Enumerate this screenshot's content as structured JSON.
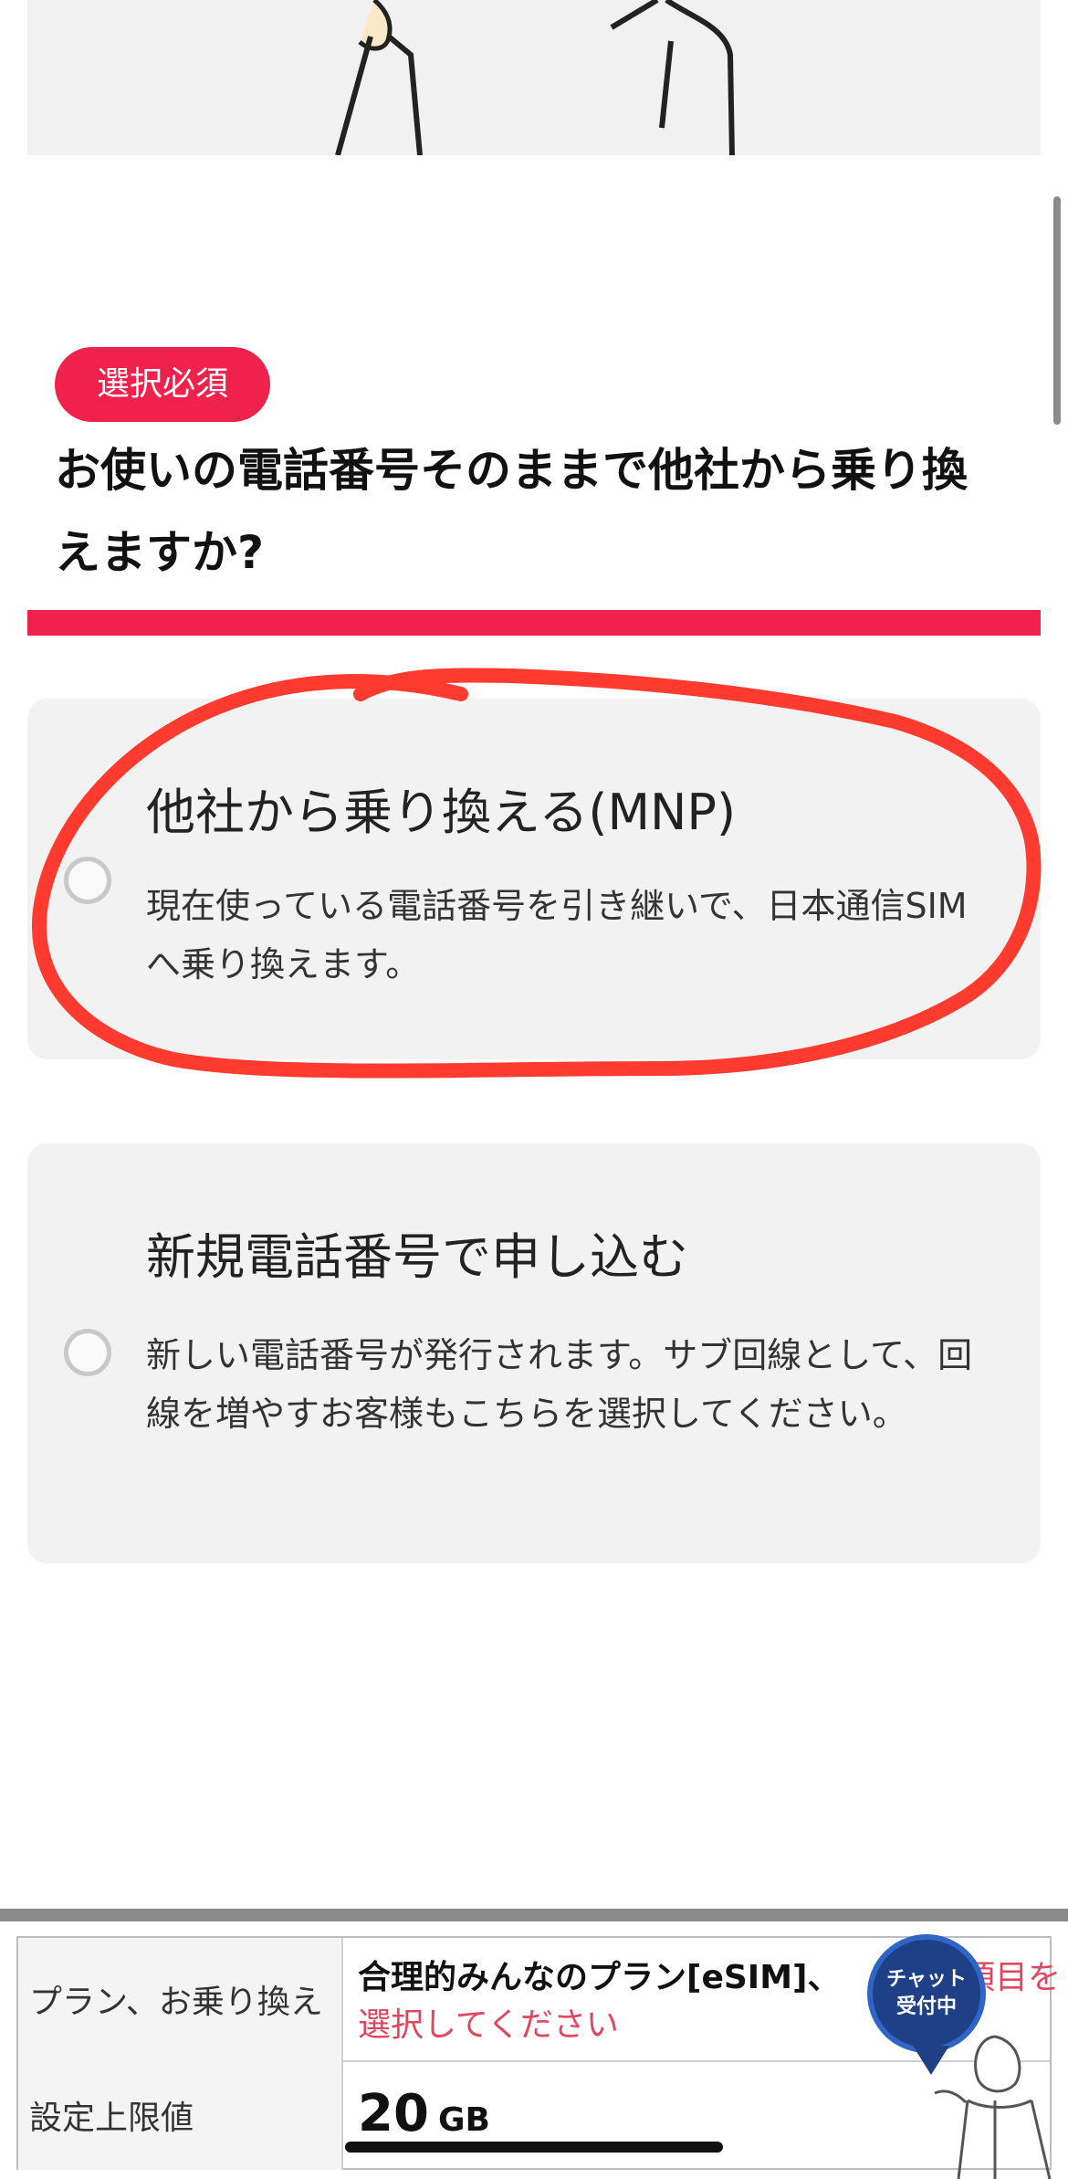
{
  "section": {
    "badge": "選択必須",
    "question": "お使いの電話番号そのままで他社から乗り換えますか?"
  },
  "options": [
    {
      "title": "他社から乗り換える(MNP)",
      "description": "現在使っている電話番号を引き継いで、日本通信SIMへ乗り換えます。",
      "selected": false
    },
    {
      "title": "新規電話番号で申し込む",
      "description": "新しい電話番号が発行されます。サブ回線として、回線を増やすお客様もこちらを選択してください。",
      "selected": false
    }
  ],
  "summary": {
    "plan_label": "プラン、お乗り換え",
    "plan_value": "合理的みんなのプラン[eSIM]、",
    "plan_alert_tail": "必須項目を",
    "plan_alert": "選択してください",
    "limit_label": "設定上限値",
    "limit_value": "20",
    "limit_unit": "GB"
  },
  "chat": {
    "line1": "チャット",
    "line2": "受付中"
  },
  "colors": {
    "accent": "#f0214a",
    "alert": "#e0475e",
    "option_bg": "#f2f2f2",
    "annotation": "#ff3b30",
    "chat_bubble": "#1f3f86"
  }
}
